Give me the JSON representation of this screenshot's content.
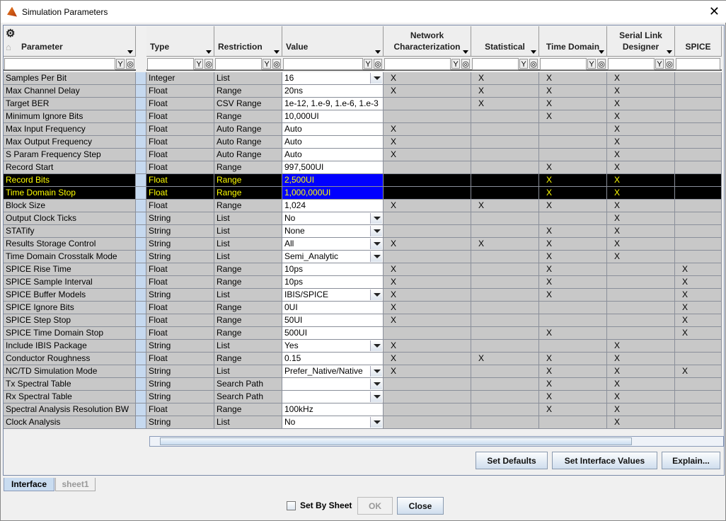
{
  "window": {
    "title": "Simulation Parameters",
    "close": "✕"
  },
  "columns": [
    {
      "label": "Parameter"
    },
    {
      "label": "Type"
    },
    {
      "label": "Restriction"
    },
    {
      "label": "Value"
    },
    {
      "label": "Network Characterization"
    },
    {
      "label": "Statistical"
    },
    {
      "label": "Time Domain"
    },
    {
      "label": "Serial Link Designer"
    },
    {
      "label": "SPICE"
    }
  ],
  "filter_icons": {
    "filter": "filter-icon",
    "clear": "clear-filter-icon"
  },
  "rows": [
    {
      "p": "Samples Per Bit",
      "t": "Integer",
      "r": "List",
      "v": "16",
      "dd": true,
      "x": "XXXX-"
    },
    {
      "p": "Max Channel Delay",
      "t": "Float",
      "r": "Range",
      "v": "20ns",
      "x": "XXXX-"
    },
    {
      "p": "Target BER",
      "t": "Float",
      "r": "CSV Range",
      "v": "1e-12, 1.e-9, 1.e-6, 1.e-3",
      "x": "-XXX-"
    },
    {
      "p": "Minimum Ignore Bits",
      "t": "Float",
      "r": "Range",
      "v": "10,000UI",
      "x": "--XX-"
    },
    {
      "p": "Max Input Frequency",
      "t": "Float",
      "r": "Auto Range",
      "v": "Auto",
      "x": "X--X-"
    },
    {
      "p": "Max Output Frequency",
      "t": "Float",
      "r": "Auto Range",
      "v": "Auto",
      "x": "X--X-"
    },
    {
      "p": "S Param Frequency Step",
      "t": "Float",
      "r": "Auto Range",
      "v": "Auto",
      "x": "X--X-"
    },
    {
      "p": "Record Start",
      "t": "Float",
      "r": "Range",
      "v": "997,500UI",
      "x": "--XX-"
    },
    {
      "p": "Record Bits",
      "t": "Float",
      "r": "Range",
      "v": "2,500UI",
      "x": "--XX-",
      "sel": true
    },
    {
      "p": "Time Domain Stop",
      "t": "Float",
      "r": "Range",
      "v": "1,000,000UI",
      "x": "--XX-",
      "sel": true
    },
    {
      "p": "Block Size",
      "t": "Float",
      "r": "Range",
      "v": "1,024",
      "x": "XXXX-"
    },
    {
      "p": "Output Clock Ticks",
      "t": "String",
      "r": "List",
      "v": "No",
      "dd": true,
      "x": "---X-"
    },
    {
      "p": "STATify",
      "t": "String",
      "r": "List",
      "v": "None",
      "dd": true,
      "x": "--XX-"
    },
    {
      "p": "Results Storage Control",
      "t": "String",
      "r": "List",
      "v": "All",
      "dd": true,
      "x": "XXXX-"
    },
    {
      "p": "Time Domain Crosstalk Mode",
      "t": "String",
      "r": "List",
      "v": "Semi_Analytic",
      "dd": true,
      "x": "--XX-"
    },
    {
      "p": "SPICE Rise Time",
      "t": "Float",
      "r": "Range",
      "v": "10ps",
      "x": "X-X-X"
    },
    {
      "p": "SPICE Sample Interval",
      "t": "Float",
      "r": "Range",
      "v": "10ps",
      "x": "X-X-X"
    },
    {
      "p": "SPICE Buffer Models",
      "t": "String",
      "r": "List",
      "v": "IBIS/SPICE",
      "dd": true,
      "x": "X-X-X"
    },
    {
      "p": "SPICE Ignore Bits",
      "t": "Float",
      "r": "Range",
      "v": "0UI",
      "x": "X---X"
    },
    {
      "p": "SPICE Step Stop",
      "t": "Float",
      "r": "Range",
      "v": "50UI",
      "x": "X---X"
    },
    {
      "p": "SPICE Time Domain Stop",
      "t": "Float",
      "r": "Range",
      "v": "500UI",
      "x": "--X-X"
    },
    {
      "p": "Include IBIS Package",
      "t": "String",
      "r": "List",
      "v": "Yes",
      "dd": true,
      "x": "X--X-"
    },
    {
      "p": "Conductor Roughness",
      "t": "Float",
      "r": "Range",
      "v": "0.15",
      "x": "XXXX-"
    },
    {
      "p": "NC/TD Simulation Mode",
      "t": "String",
      "r": "List",
      "v": "Prefer_Native/Native",
      "dd": true,
      "x": "X-XXX"
    },
    {
      "p": "Tx Spectral Table",
      "t": "String",
      "r": "Search Path",
      "v": "",
      "dd": true,
      "x": "--XX-"
    },
    {
      "p": "Rx Spectral Table",
      "t": "String",
      "r": "Search Path",
      "v": "",
      "dd": true,
      "x": "--XX-"
    },
    {
      "p": "Spectral Analysis Resolution BW",
      "t": "Float",
      "r": "Range",
      "v": "100kHz",
      "x": "--XX-"
    },
    {
      "p": "Clock Analysis",
      "t": "String",
      "r": "List",
      "v": "No",
      "dd": true,
      "x": "---X-"
    }
  ],
  "mark": "X",
  "buttons": {
    "set_defaults": "Set Defaults",
    "set_interface": "Set Interface Values",
    "explain": "Explain...",
    "ok": "OK",
    "close": "Close"
  },
  "tabs": [
    "Interface",
    "sheet1"
  ],
  "set_by_sheet": "Set By Sheet"
}
